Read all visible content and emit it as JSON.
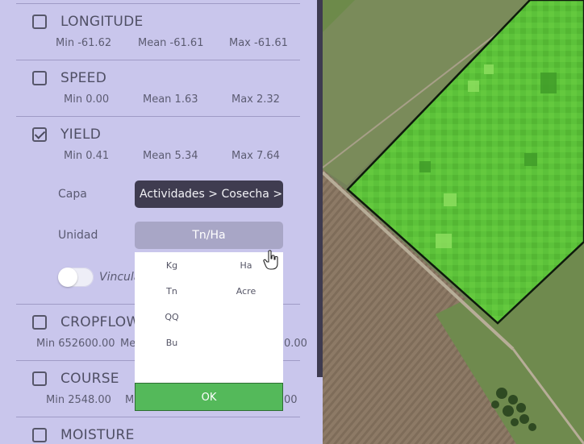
{
  "layers": [
    {
      "name": "LONGITUDE",
      "checked": false,
      "min": "Min -61.62",
      "mean": "Mean -61.61",
      "max": "Max -61.61"
    },
    {
      "name": "SPEED",
      "checked": false,
      "min": "Min 0.00",
      "mean": "Mean 1.63",
      "max": "Max 2.32"
    },
    {
      "name": "YIELD",
      "checked": true,
      "min": "Min 0.41",
      "mean": "Mean 5.34",
      "max": "Max 7.64"
    },
    {
      "name": "CROPFLOW",
      "checked": false,
      "min": "Min 652600.00",
      "mean": "Me",
      "max": "0.00"
    },
    {
      "name": "COURSE",
      "checked": false,
      "min": "Min 2548.00",
      "mean": "M",
      "max": "00"
    },
    {
      "name": "MOISTURE",
      "checked": false
    }
  ],
  "yield_options": {
    "capa_label": "Capa",
    "capa_value": "Actividades > Cosecha > Ren",
    "unidad_label": "Unidad",
    "unidad_value": "Tn/Ha",
    "toggle_label": "Vincula",
    "toggle_on": false
  },
  "dropdown": {
    "left_options": [
      "Kg",
      "Tn",
      "QQ",
      "Bu"
    ],
    "right_options": [
      "Ha",
      "Acre"
    ],
    "ok_label": "OK"
  },
  "colors": {
    "panel_bg": "#c9c6ec",
    "capa_bg": "#3f3c50",
    "unidad_bg": "#a8a6c6",
    "ok_bg": "#54b95a",
    "field_green": "#5cc23a"
  }
}
